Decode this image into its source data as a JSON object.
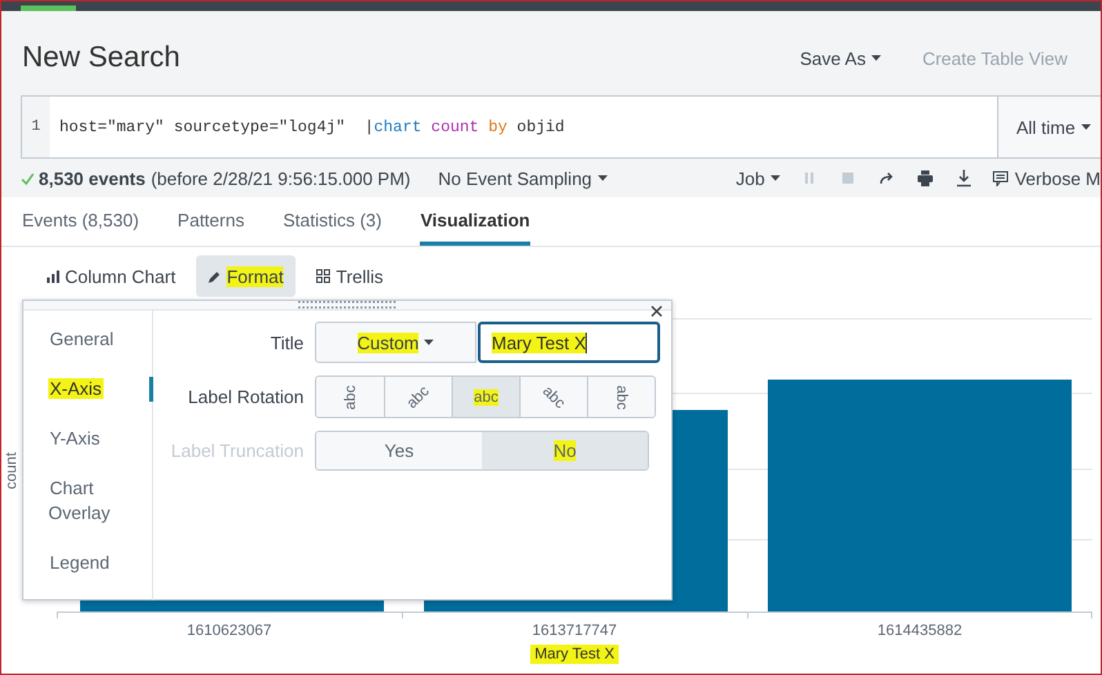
{
  "window": {
    "title": "New Search"
  },
  "header_actions": [
    {
      "label": "Save As",
      "kind": "menu",
      "disabled": false
    },
    {
      "label": "Create Table View",
      "kind": "button",
      "disabled": true
    }
  ],
  "search": {
    "line_number": "1",
    "tokens": [
      {
        "text": "host=\"mary\" sourcetype=\"log4j\"  |",
        "kind": "plain"
      },
      {
        "text": "chart",
        "kind": "command"
      },
      {
        "text": " count",
        "kind": "function"
      },
      {
        "text": " by",
        "kind": "keyword"
      },
      {
        "text": " objid",
        "kind": "plain"
      }
    ],
    "time_range": "All time"
  },
  "status": {
    "event_count": "8,530 events",
    "time_note": "(before 2/28/21 9:56:15.000 PM)",
    "sampling": "No Event Sampling",
    "job": "Job",
    "mode": "Verbose M"
  },
  "tabs": [
    {
      "label": "Events (8,530)",
      "selected": false
    },
    {
      "label": "Patterns",
      "selected": false
    },
    {
      "label": "Statistics (3)",
      "selected": false
    },
    {
      "label": "Visualization",
      "selected": true
    }
  ],
  "viz_toolbar": [
    {
      "label": "Column Chart",
      "kind": "chart-type",
      "pressed": false,
      "highlighted": false
    },
    {
      "label": "Format",
      "kind": "format",
      "pressed": true,
      "highlighted": true
    },
    {
      "label": "Trellis",
      "kind": "trellis",
      "pressed": false,
      "highlighted": false
    }
  ],
  "format_panel": {
    "sections": [
      {
        "label": "General",
        "selected": false,
        "highlighted": false
      },
      {
        "label": "X-Axis",
        "selected": true,
        "highlighted": true
      },
      {
        "label": "Y-Axis",
        "selected": false,
        "highlighted": false
      },
      {
        "label": "Chart Overlay",
        "selected": false,
        "highlighted": false
      },
      {
        "label": "Legend",
        "selected": false,
        "highlighted": false
      }
    ],
    "title_row": {
      "label": "Title",
      "mode": "Custom",
      "mode_highlighted": true,
      "value": "Mary Test X",
      "value_highlighted": true
    },
    "rotation_row": {
      "label": "Label Rotation",
      "options": [
        {
          "text": "abc",
          "kind": "up",
          "selected": false,
          "highlighted": false
        },
        {
          "text": "abc",
          "kind": "half-up",
          "selected": false,
          "highlighted": false
        },
        {
          "text": "abc",
          "kind": "flat",
          "selected": true,
          "highlighted": true
        },
        {
          "text": "abc",
          "kind": "half-down",
          "selected": false,
          "highlighted": false
        },
        {
          "text": "abc",
          "kind": "down",
          "selected": false,
          "highlighted": false
        }
      ]
    },
    "truncation_row": {
      "label": "Label Truncation",
      "disabled": true,
      "options": [
        {
          "label": "Yes",
          "selected": false,
          "highlighted": false
        },
        {
          "label": "No",
          "selected": true,
          "highlighted": true
        }
      ]
    }
  },
  "chart": {
    "y_title": "count",
    "categories": [
      "1610623067",
      "1613717747",
      "1614435882"
    ],
    "x_title": "Mary Test X",
    "x_title_highlighted": true
  }
}
